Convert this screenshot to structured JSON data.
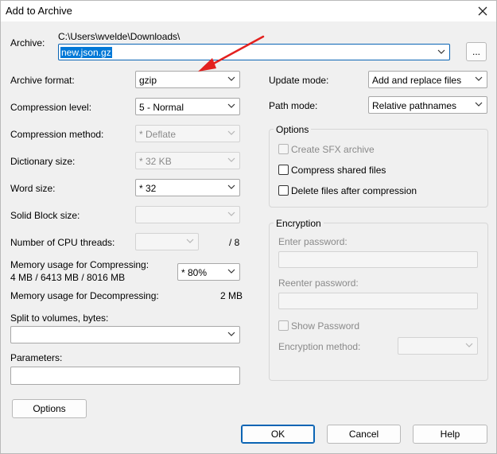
{
  "window": {
    "title": "Add to Archive"
  },
  "archive": {
    "label": "Archive:",
    "path": "C:\\Users\\wvelde\\Downloads\\",
    "filename": "new.json.gz",
    "browse_label": "..."
  },
  "left": {
    "format": {
      "label": "Archive format:",
      "value": "gzip"
    },
    "level": {
      "label": "Compression level:",
      "value": "5 - Normal"
    },
    "method": {
      "label": "Compression method:",
      "value": "*  Deflate"
    },
    "dict": {
      "label": "Dictionary size:",
      "value": "*  32 KB"
    },
    "word": {
      "label": "Word size:",
      "value": "*  32"
    },
    "solid": {
      "label": "Solid Block size:",
      "value": ""
    },
    "threads": {
      "label": "Number of CPU threads:",
      "value": "",
      "max": "/ 8"
    },
    "mem_comp": {
      "label": "Memory usage for Compressing:",
      "detail": "4 MB / 6413 MB / 8016 MB",
      "value": "* 80%"
    },
    "mem_decomp": {
      "label": "Memory usage for Decompressing:",
      "value": "2 MB"
    },
    "split": {
      "label": "Split to volumes, bytes:",
      "value": ""
    },
    "params": {
      "label": "Parameters:",
      "value": ""
    },
    "options_btn": "Options"
  },
  "right": {
    "update": {
      "label": "Update mode:",
      "value": "Add and replace files"
    },
    "pathmode": {
      "label": "Path mode:",
      "value": "Relative pathnames"
    },
    "options": {
      "title": "Options",
      "sfx": "Create SFX archive",
      "shared": "Compress shared files",
      "delete": "Delete files after compression"
    },
    "encryption": {
      "title": "Encryption",
      "enter_pw": "Enter password:",
      "reenter_pw": "Reenter password:",
      "show_pw": "Show Password",
      "method_label": "Encryption method:",
      "method_value": ""
    }
  },
  "buttons": {
    "ok": "OK",
    "cancel": "Cancel",
    "help": "Help"
  },
  "annotation": {
    "arrow_color": "#e3211f"
  }
}
